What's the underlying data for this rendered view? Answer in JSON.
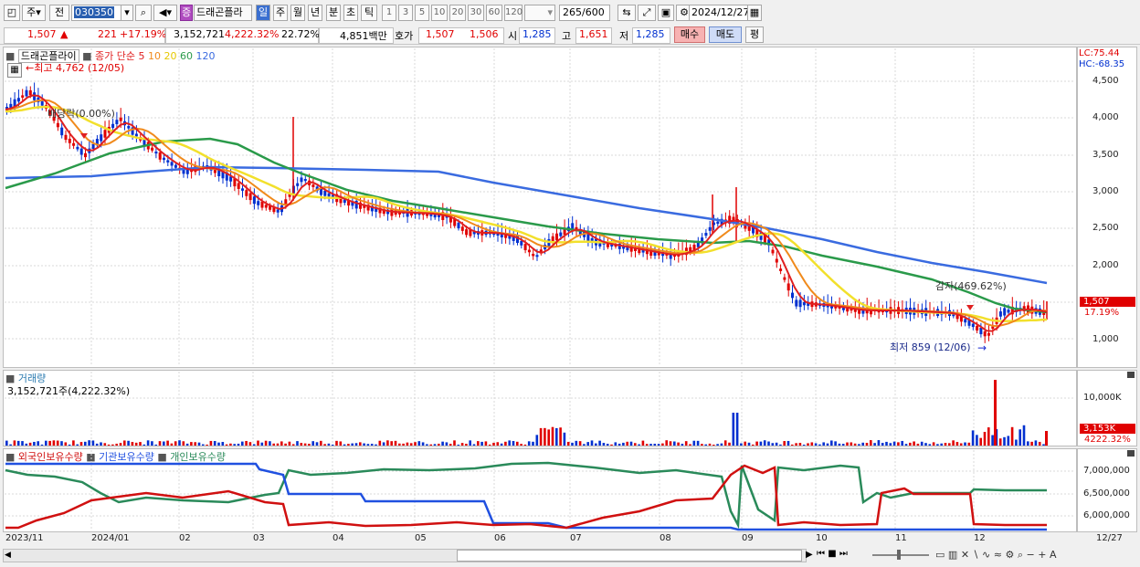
{
  "toolbar": {
    "market": "주",
    "market_sub": "전",
    "code": "030350",
    "stock_name": "드래곤플라",
    "badge": "증",
    "periods": [
      "일",
      "주",
      "월",
      "년",
      "분",
      "초",
      "틱"
    ],
    "minutes": [
      "1",
      "3",
      "5",
      "10",
      "20",
      "30",
      "60",
      "120"
    ],
    "count": "265",
    "count_total": "/600",
    "date": "2024/12/27"
  },
  "quote": {
    "price": "1,507",
    "arrow": "▲",
    "change": "221",
    "change_pct": "+17.19%",
    "volume": "3,152,721",
    "vol_pct": "4,222.32%",
    "turnover": "22.72%",
    "amount": "4,851백만",
    "ask_label": "호가",
    "ask": "1,507",
    "bid": "1,506",
    "open_label": "시",
    "open": "1,285",
    "high_label": "고",
    "high": "1,651",
    "low_label": "저",
    "low": "1,285",
    "buy": "매수",
    "sell": "매도",
    "avg": "평"
  },
  "price_panel": {
    "name": "드래곤플라이",
    "legend_label": "종가 단순",
    "ma": [
      {
        "period": "5",
        "color": "#e02020"
      },
      {
        "period": "10",
        "color": "#f08a1c"
      },
      {
        "period": "20",
        "color": "#f2e02c"
      },
      {
        "period": "60",
        "color": "#2a9a4a"
      },
      {
        "period": "120",
        "color": "#3a6be0"
      }
    ],
    "high_note": "←최고 4,762 (12/05)",
    "low_note": "최저 859 (12/06)",
    "event1": "배당락(0.00%)",
    "event2": "감자(469.62%)",
    "lc": "LC:75.44",
    "hc": "HC:-68.35",
    "last_price": "1,507",
    "last_pct": "17.19%",
    "yticks": [
      "4,500",
      "4,000",
      "3,500",
      "3,000",
      "2,500",
      "2,000",
      "1,500",
      "1,000"
    ]
  },
  "volume_panel": {
    "title": "거래량",
    "value": "3,152,721주(4,222.32%)",
    "ytick": "10,000K",
    "last": "3,153K",
    "last_pct": "4222.32%"
  },
  "holding_panel": {
    "legend": [
      {
        "label": "외국인보유수량",
        "color": "#d01010"
      },
      {
        "label": "기관보유수량",
        "color": "#2050e0"
      },
      {
        "label": "개인보유수량",
        "color": "#2a8a5a"
      }
    ],
    "yticks": [
      "7,000,000",
      "6,500,000",
      "6,000,000"
    ]
  },
  "xaxis": [
    "2023/11",
    "2024/01",
    "02",
    "03",
    "04",
    "05",
    "06",
    "07",
    "08",
    "09",
    "10",
    "11",
    "12",
    "12/27"
  ],
  "colors": {
    "up": "#e00000",
    "down": "#0030d0"
  }
}
